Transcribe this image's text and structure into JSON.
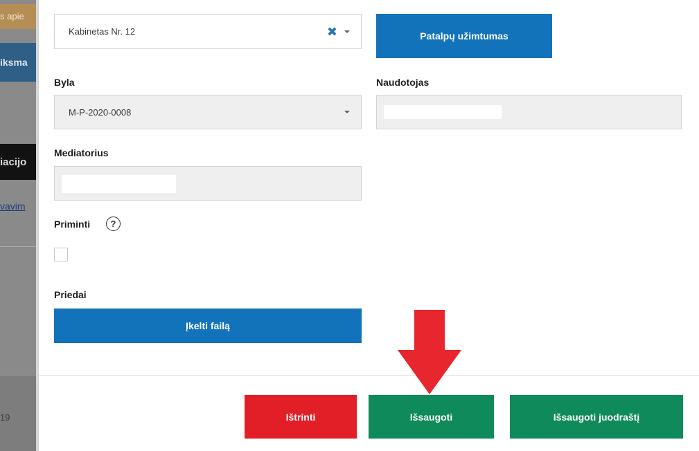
{
  "background": {
    "chip1_text": "s apie",
    "chip2_text": "iksma",
    "chip3_text": "iacijo",
    "link_text": "vavim",
    "footer_number": "19"
  },
  "form": {
    "room_select": {
      "value": "Kabinetas Nr. 12"
    },
    "room_occupancy_button": "Patalpų užimtumas",
    "case": {
      "label": "Byla",
      "value": "M-P-2020-0008"
    },
    "user": {
      "label": "Naudotojas",
      "value": ""
    },
    "mediator": {
      "label": "Mediatorius",
      "value": ""
    },
    "remind": {
      "label": "Priminti",
      "help_glyph": "?",
      "checked": false
    },
    "attachments": {
      "label": "Priedai",
      "upload_button": "Įkelti failą"
    }
  },
  "actions": {
    "delete": "Ištrinti",
    "save": "Išsaugoti",
    "save_draft": "Išsaugoti juodraštį"
  },
  "icons": {
    "clear": "close-icon",
    "caret": "chevron-down-icon",
    "help": "question-circle-icon",
    "annotation": "arrow-down-icon"
  },
  "colors": {
    "primary_blue": "#1273bb",
    "danger_red": "#e21e26",
    "success_green": "#0f8a5a",
    "clear_icon_blue": "#2a73b7",
    "annotation_arrow_red": "#e8262d"
  }
}
